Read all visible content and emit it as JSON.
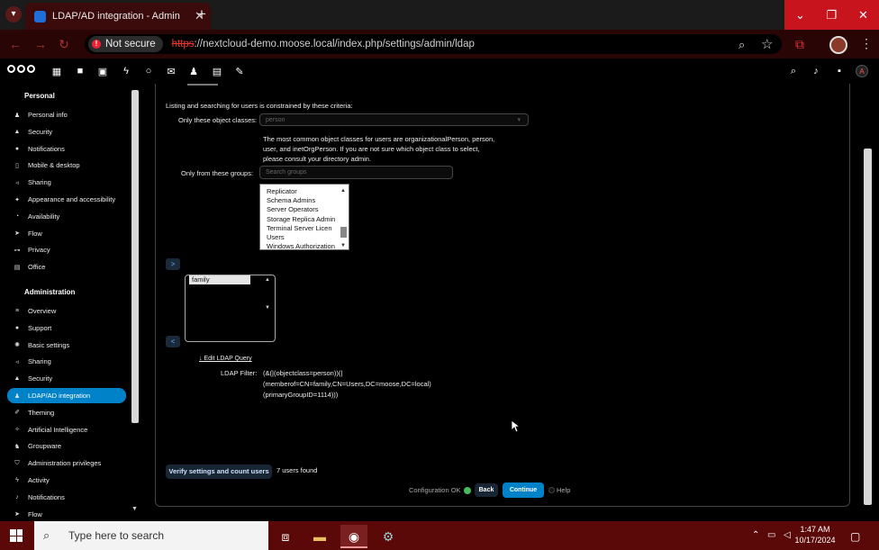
{
  "browser": {
    "tab_title": "LDAP/AD integration - Admin",
    "tab_close": "✕",
    "new_tab": "+",
    "security_label": "Not secure",
    "url_scheme": "https",
    "url_rest": "://nextcloud-demo.moose.local/index.php/settings/admin/ldap"
  },
  "sidebar": {
    "personal_title": "Personal",
    "personal_items": [
      {
        "label": "Personal info",
        "icon": "person-icon"
      },
      {
        "label": "Security",
        "icon": "lock-icon"
      },
      {
        "label": "Notifications",
        "icon": "chat-icon"
      },
      {
        "label": "Mobile & desktop",
        "icon": "phone-icon"
      },
      {
        "label": "Sharing",
        "icon": "share-icon"
      },
      {
        "label": "Appearance and accessibility",
        "icon": "accessibility-icon"
      },
      {
        "label": "Availability",
        "icon": "clock-icon"
      },
      {
        "label": "Flow",
        "icon": "flow-icon"
      },
      {
        "label": "Privacy",
        "icon": "key-icon"
      },
      {
        "label": "Office",
        "icon": "doc-icon"
      }
    ],
    "admin_title": "Administration",
    "admin_items": [
      {
        "label": "Overview",
        "icon": "sliders-icon"
      },
      {
        "label": "Support",
        "icon": "chat-icon"
      },
      {
        "label": "Basic settings",
        "icon": "gear-icon"
      },
      {
        "label": "Sharing",
        "icon": "share-icon"
      },
      {
        "label": "Security",
        "icon": "lock-icon"
      },
      {
        "label": "LDAP/AD integration",
        "icon": "person-icon",
        "active": true
      },
      {
        "label": "Theming",
        "icon": "brush-icon"
      },
      {
        "label": "Artificial Intelligence",
        "icon": "sparkle-icon"
      },
      {
        "label": "Groupware",
        "icon": "group-icon"
      },
      {
        "label": "Administration privileges",
        "icon": "shield-icon"
      },
      {
        "label": "Activity",
        "icon": "bolt-icon"
      },
      {
        "label": "Notifications",
        "icon": "bell-icon"
      },
      {
        "label": "Flow",
        "icon": "flow-icon"
      }
    ]
  },
  "ldap": {
    "intro": "Listing and searching for users is constrained by these criteria:",
    "object_classes_label": "Only these object classes:",
    "object_classes_value": "person",
    "hint_lines": [
      "The most common object classes for users are organizationalPerson, person,",
      "user, and inetOrgPerson. If you are not sure which object class to select,",
      "please consult your directory admin."
    ],
    "groups_label": "Only from these groups:",
    "groups_placeholder": "Search groups",
    "available_groups": [
      "Replicator",
      "Schema Admins",
      "Server Operators",
      "Storage Replica Admin",
      "Terminal Server Licen",
      "Users",
      "Windows Authorization"
    ],
    "add_btn": ">",
    "remove_btn": "<",
    "selected_groups": [
      "family"
    ],
    "edit_query": "↓ Edit LDAP Query",
    "filter_label": "LDAP Filter:",
    "filter_lines": [
      "(&(|(objectclass=person))(|",
      "(memberof=CN=family,CN=Users,DC=moose,DC=local)",
      "(primaryGroupID=1114)))"
    ],
    "verify_btn": "Verify settings and count users",
    "users_found": "7 users found",
    "config_status": "Configuration OK",
    "back_btn": "Back",
    "continue_btn": "Continue",
    "help": "Help"
  },
  "taskbar": {
    "search_placeholder": "Type here to search",
    "time": "1:47 AM",
    "date": "10/17/2024"
  }
}
